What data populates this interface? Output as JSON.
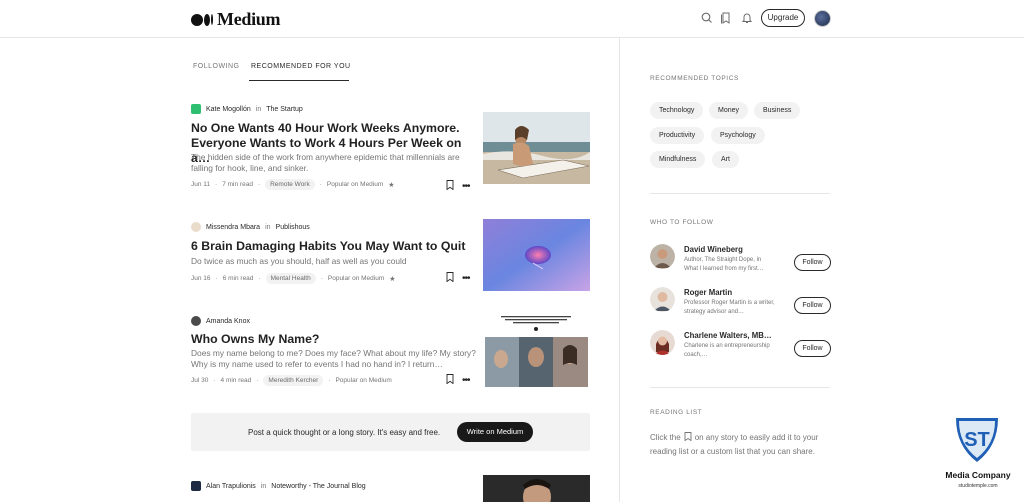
{
  "header": {
    "brand": "Medium",
    "upgrade_label": "Upgrade",
    "icons": [
      "search-icon",
      "lists-icon",
      "bell-icon"
    ]
  },
  "tabs": [
    {
      "label": "FOLLOWING",
      "active": false
    },
    {
      "label": "RECOMMENDED FOR YOU",
      "active": true
    }
  ],
  "articles": [
    {
      "author": "Kate Mogollón",
      "in_word": "in",
      "publication": "The Startup",
      "title": "No One Wants 40 Hour Work Weeks Anymore. Everyone Wants to Work 4 Hours Per Week on a…",
      "subtitle": "The hidden side of the work from anywhere epidemic that millennials are falling for hook, line, and sinker.",
      "date": "Jun 11",
      "read_time": "7 min read",
      "tag": "Remote Work",
      "badge": "Popular on Medium",
      "thumb": "beach-surfboard-photo"
    },
    {
      "author": "Missendra Mbara",
      "in_word": "in",
      "publication": "Publishous",
      "title": "6 Brain Damaging Habits You May Want to Quit",
      "subtitle": "Do twice as much as you should, half as well as you could",
      "date": "Jun 16",
      "read_time": "6 min read",
      "tag": "Mental Health",
      "badge": "Popular on Medium",
      "thumb": "brain-illustration"
    },
    {
      "author": "Amanda Knox",
      "in_word": "",
      "publication": "",
      "title": "Who Owns My Name?",
      "subtitle": "Does my name belong to me? Does my face? What about my life? My story? Why is my name used to refer to events I had no hand in? I return…",
      "date": "Jul 30",
      "read_time": "4 min read",
      "tag": "Meredith Kercher",
      "badge": "Popular on Medium",
      "thumb": "collage-photo"
    },
    {
      "author": "Alan Trapulionis",
      "in_word": "in",
      "publication": "Noteworthy - The Journal Blog",
      "thumb": "portrait-photo"
    }
  ],
  "cta": {
    "text": "Post a quick thought or a long story. It's easy and free.",
    "button": "Write on Medium"
  },
  "sidebar": {
    "topics_label": "RECOMMENDED TOPICS",
    "topics": [
      "Technology",
      "Money",
      "Business",
      "Productivity",
      "Psychology",
      "Mindfulness",
      "Art"
    ],
    "who_label": "WHO TO FOLLOW",
    "follow_label": "Follow",
    "people": [
      {
        "name": "David Wineberg",
        "bio": "Author, The Straight Dope, in What I learned from my first…"
      },
      {
        "name": "Roger Martin",
        "bio": "Professor Roger Martin is a writer, strategy advisor and…"
      },
      {
        "name": "Charlene Walters, MB…",
        "bio": "Charlene is an entrepreneurship coach,…"
      }
    ],
    "reading_label": "READING LIST",
    "reading_before": "Click the",
    "reading_after": "on any story to easily add it to your reading list or a custom list that you can share."
  },
  "watermark": {
    "badge_text": "ST",
    "title": "Media Company",
    "subtitle": "studiotemple.com"
  },
  "colors": {
    "text": "#292929",
    "muted": "#757575",
    "pill_bg": "#f2f2f2",
    "cta_button": "#191919",
    "logo_blue": "#1f5fb5"
  }
}
